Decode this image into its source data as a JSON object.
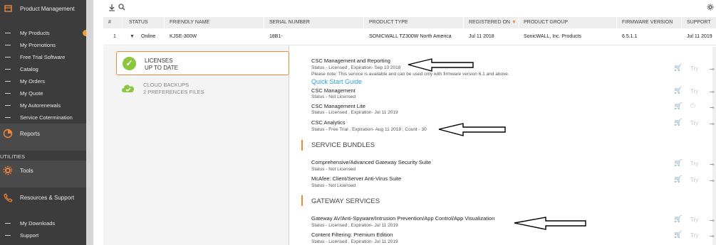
{
  "sidebar": {
    "product_management": "Product Management",
    "items": [
      {
        "label": "My Products"
      },
      {
        "label": "My Promotions"
      },
      {
        "label": "Free Trial Software"
      },
      {
        "label": "Catalog"
      },
      {
        "label": "My Orders"
      },
      {
        "label": "My Quote"
      },
      {
        "label": "My Autorenewals"
      },
      {
        "label": "Service Cotermination"
      }
    ],
    "reports": "Reports",
    "utilities": "UTILITIES",
    "tools": "Tools",
    "resources": "Resources & Support",
    "downloads": "My Downloads",
    "support": "Support"
  },
  "table": {
    "headers": {
      "num": "#",
      "status": "STATUS",
      "friendly": "FRIENDLY NAME",
      "serial": "SERIAL NUMBER",
      "type": "PRODUCT TYPE",
      "registered": "REGISTERED ON",
      "group": "PRODUCT GROUP",
      "firmware": "FIRMWARE VERSION",
      "support": "SUPPORT"
    },
    "row": {
      "num": "1",
      "status": "Online",
      "friendly": "KJSE-300W",
      "serial": "18B1-",
      "type": "SONICWALL TZ300W North America",
      "registered": "Jul 11 2018",
      "group": "SonicWALL, Inc. Products",
      "firmware": "6.5.1.1",
      "support": "Jul 11 2019"
    }
  },
  "left_panel": {
    "licenses_line1": "LICENSES",
    "licenses_line2": "UP TO DATE",
    "cloud_line1": "CLOUD BACKUPS",
    "cloud_line2": "2 PREFERENCES FILES"
  },
  "services": {
    "csc_mr": {
      "name": "CSC Management and Reporting",
      "status": "Status - Licensed , Expiration- Sep 10 2018",
      "note": "Please note: This service is available and can be used only with firmware version 6.1 and above."
    },
    "quick_start": "Quick Start Guide",
    "csc_m": {
      "name": "CSC Management",
      "status": "Status - Not Licensed"
    },
    "csc_lite": {
      "name": "CSC Management Lite",
      "status": "Status - Licensed , Expiration- Jul 11 2019"
    },
    "csc_analytics": {
      "name": "CSC Analytics",
      "status": "Status - Free Trial , Expiration- Aug 11 2018 , Count - 30"
    },
    "bundles_header": "SERVICE BUNDLES",
    "cgss": {
      "name": "Comprehensive/Advanced Gateway Security Suite",
      "status": "Status - Not Licensed"
    },
    "mcafee": {
      "name": "McAfee: Client/Server Anti-Virus Suite",
      "status": "Status - Not Licensed"
    },
    "gateway_header": "GATEWAY SERVICES",
    "gav": {
      "name": "Gateway AV/Anti-Spyware/Intrusion Prevention/App Control/App Visualization",
      "status": "Status - Licensed , Expiration- Jul 11 2019"
    },
    "cfs": {
      "name": "Content Filtering: Premium Edition",
      "status": "Status - Licensed , Expiration- Jul 11 2019"
    }
  },
  "try_label": "Try",
  "colors": {
    "accent": "#f0873a",
    "sidebar": "#3c3c3c",
    "success": "#8cc63f",
    "link": "#2a9fd8"
  }
}
